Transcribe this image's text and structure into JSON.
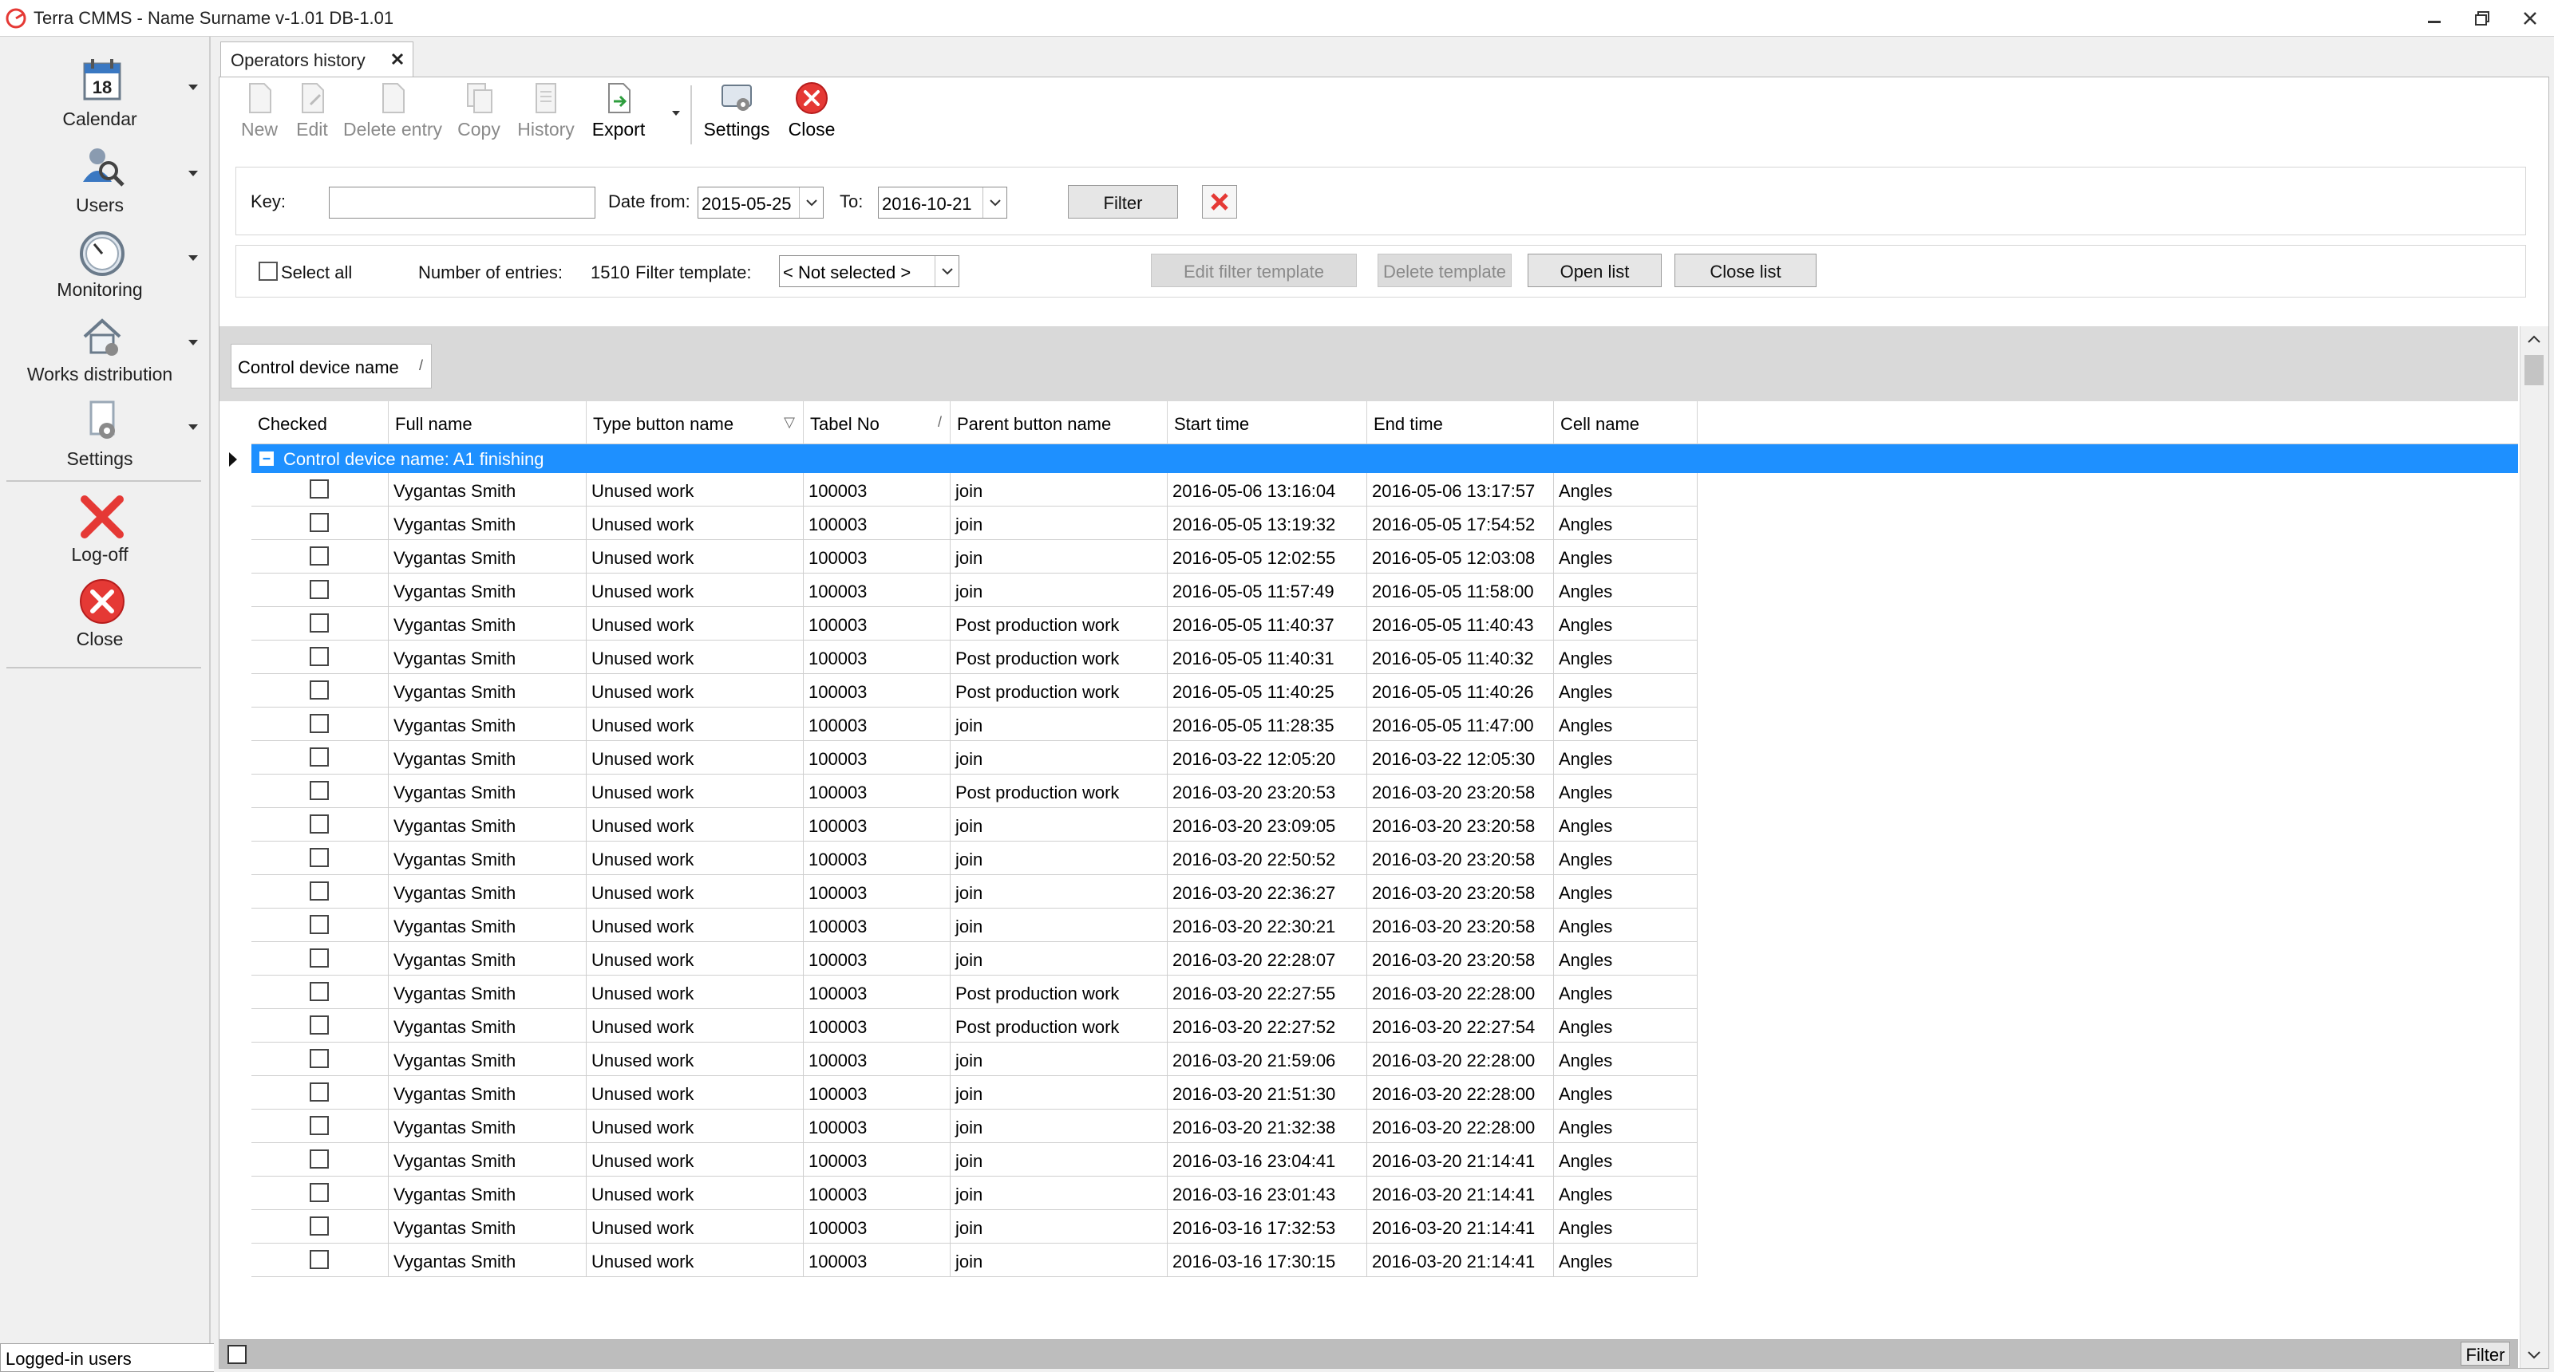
{
  "titlebar": {
    "title": "Terra CMMS - Name Surname  v-1.01 DB-1.01"
  },
  "sidebar": {
    "items": [
      {
        "label": "Calendar",
        "icon": "calendar-icon",
        "badge": "18"
      },
      {
        "label": "Users",
        "icon": "users-icon"
      },
      {
        "label": "Monitoring",
        "icon": "monitoring-icon"
      },
      {
        "label": "Works distribution",
        "icon": "works-distribution-icon"
      },
      {
        "label": "Settings",
        "icon": "settings-icon"
      },
      {
        "label": "Log-off",
        "icon": "log-off-icon"
      },
      {
        "label": "Close",
        "icon": "close-icon"
      }
    ],
    "logged_users": "Logged-in users"
  },
  "tab": {
    "label": "Operators history"
  },
  "toolbar": {
    "new": "New",
    "edit": "Edit",
    "delete_entry": "Delete entry",
    "copy": "Copy",
    "history": "History",
    "export": "Export",
    "settings": "Settings",
    "close": "Close"
  },
  "filter": {
    "key_label": "Key:",
    "key_value": "",
    "date_from_label": "Date from:",
    "date_from": "2015-05-25",
    "to_label": "To:",
    "date_to": "2016-10-21",
    "filter_button": "Filter"
  },
  "list_bar": {
    "select_all": "Select all",
    "entries_label": "Number of entries:",
    "entries_count": "1510",
    "template_label": "Filter template:",
    "template_value": "< Not selected >",
    "edit_template": "Edit filter template",
    "delete_template": "Delete template",
    "open_list": "Open list",
    "close_list": "Close list"
  },
  "grid": {
    "group_chip": "Control device name",
    "columns": [
      "Checked",
      "Full name",
      "Type button name",
      "Tabel No",
      "Parent button name",
      "Start time",
      "End time",
      "Cell name"
    ],
    "group_row": "Control device name: A1 finishing",
    "rows": [
      [
        "Vygantas Smith",
        "Unused work",
        "100003",
        "join",
        "2016-05-06 13:16:04",
        "2016-05-06 13:17:57",
        "Angles"
      ],
      [
        "Vygantas Smith",
        "Unused work",
        "100003",
        "join",
        "2016-05-05 13:19:32",
        "2016-05-05 17:54:52",
        "Angles"
      ],
      [
        "Vygantas Smith",
        "Unused work",
        "100003",
        "join",
        "2016-05-05 12:02:55",
        "2016-05-05 12:03:08",
        "Angles"
      ],
      [
        "Vygantas Smith",
        "Unused work",
        "100003",
        "join",
        "2016-05-05 11:57:49",
        "2016-05-05 11:58:00",
        "Angles"
      ],
      [
        "Vygantas Smith",
        "Unused work",
        "100003",
        "Post production work",
        "2016-05-05 11:40:37",
        "2016-05-05 11:40:43",
        "Angles"
      ],
      [
        "Vygantas Smith",
        "Unused work",
        "100003",
        "Post production work",
        "2016-05-05 11:40:31",
        "2016-05-05 11:40:32",
        "Angles"
      ],
      [
        "Vygantas Smith",
        "Unused work",
        "100003",
        "Post production work",
        "2016-05-05 11:40:25",
        "2016-05-05 11:40:26",
        "Angles"
      ],
      [
        "Vygantas Smith",
        "Unused work",
        "100003",
        "join",
        "2016-05-05 11:28:35",
        "2016-05-05 11:47:00",
        "Angles"
      ],
      [
        "Vygantas Smith",
        "Unused work",
        "100003",
        "join",
        "2016-03-22 12:05:20",
        "2016-03-22 12:05:30",
        "Angles"
      ],
      [
        "Vygantas Smith",
        "Unused work",
        "100003",
        "Post production work",
        "2016-03-20 23:20:53",
        "2016-03-20 23:20:58",
        "Angles"
      ],
      [
        "Vygantas Smith",
        "Unused work",
        "100003",
        "join",
        "2016-03-20 23:09:05",
        "2016-03-20 23:20:58",
        "Angles"
      ],
      [
        "Vygantas Smith",
        "Unused work",
        "100003",
        "join",
        "2016-03-20 22:50:52",
        "2016-03-20 23:20:58",
        "Angles"
      ],
      [
        "Vygantas Smith",
        "Unused work",
        "100003",
        "join",
        "2016-03-20 22:36:27",
        "2016-03-20 23:20:58",
        "Angles"
      ],
      [
        "Vygantas Smith",
        "Unused work",
        "100003",
        "join",
        "2016-03-20 22:30:21",
        "2016-03-20 23:20:58",
        "Angles"
      ],
      [
        "Vygantas Smith",
        "Unused work",
        "100003",
        "join",
        "2016-03-20 22:28:07",
        "2016-03-20 23:20:58",
        "Angles"
      ],
      [
        "Vygantas Smith",
        "Unused work",
        "100003",
        "Post production work",
        "2016-03-20 22:27:55",
        "2016-03-20 22:28:00",
        "Angles"
      ],
      [
        "Vygantas Smith",
        "Unused work",
        "100003",
        "Post production work",
        "2016-03-20 22:27:52",
        "2016-03-20 22:27:54",
        "Angles"
      ],
      [
        "Vygantas Smith",
        "Unused work",
        "100003",
        "join",
        "2016-03-20 21:59:06",
        "2016-03-20 22:28:00",
        "Angles"
      ],
      [
        "Vygantas Smith",
        "Unused work",
        "100003",
        "join",
        "2016-03-20 21:51:30",
        "2016-03-20 22:28:00",
        "Angles"
      ],
      [
        "Vygantas Smith",
        "Unused work",
        "100003",
        "join",
        "2016-03-20 21:32:38",
        "2016-03-20 22:28:00",
        "Angles"
      ],
      [
        "Vygantas Smith",
        "Unused work",
        "100003",
        "join",
        "2016-03-16 23:04:41",
        "2016-03-20 21:14:41",
        "Angles"
      ],
      [
        "Vygantas Smith",
        "Unused work",
        "100003",
        "join",
        "2016-03-16 23:01:43",
        "2016-03-20 21:14:41",
        "Angles"
      ],
      [
        "Vygantas Smith",
        "Unused work",
        "100003",
        "join",
        "2016-03-16 17:32:53",
        "2016-03-20 21:14:41",
        "Angles"
      ],
      [
        "Vygantas Smith",
        "Unused work",
        "100003",
        "join",
        "2016-03-16 17:30:15",
        "2016-03-20 21:14:41",
        "Angles"
      ]
    ],
    "footer_filter": "Filter"
  },
  "colors": {
    "group_row": "#1e90ff",
    "accent_red": "#e53935"
  }
}
